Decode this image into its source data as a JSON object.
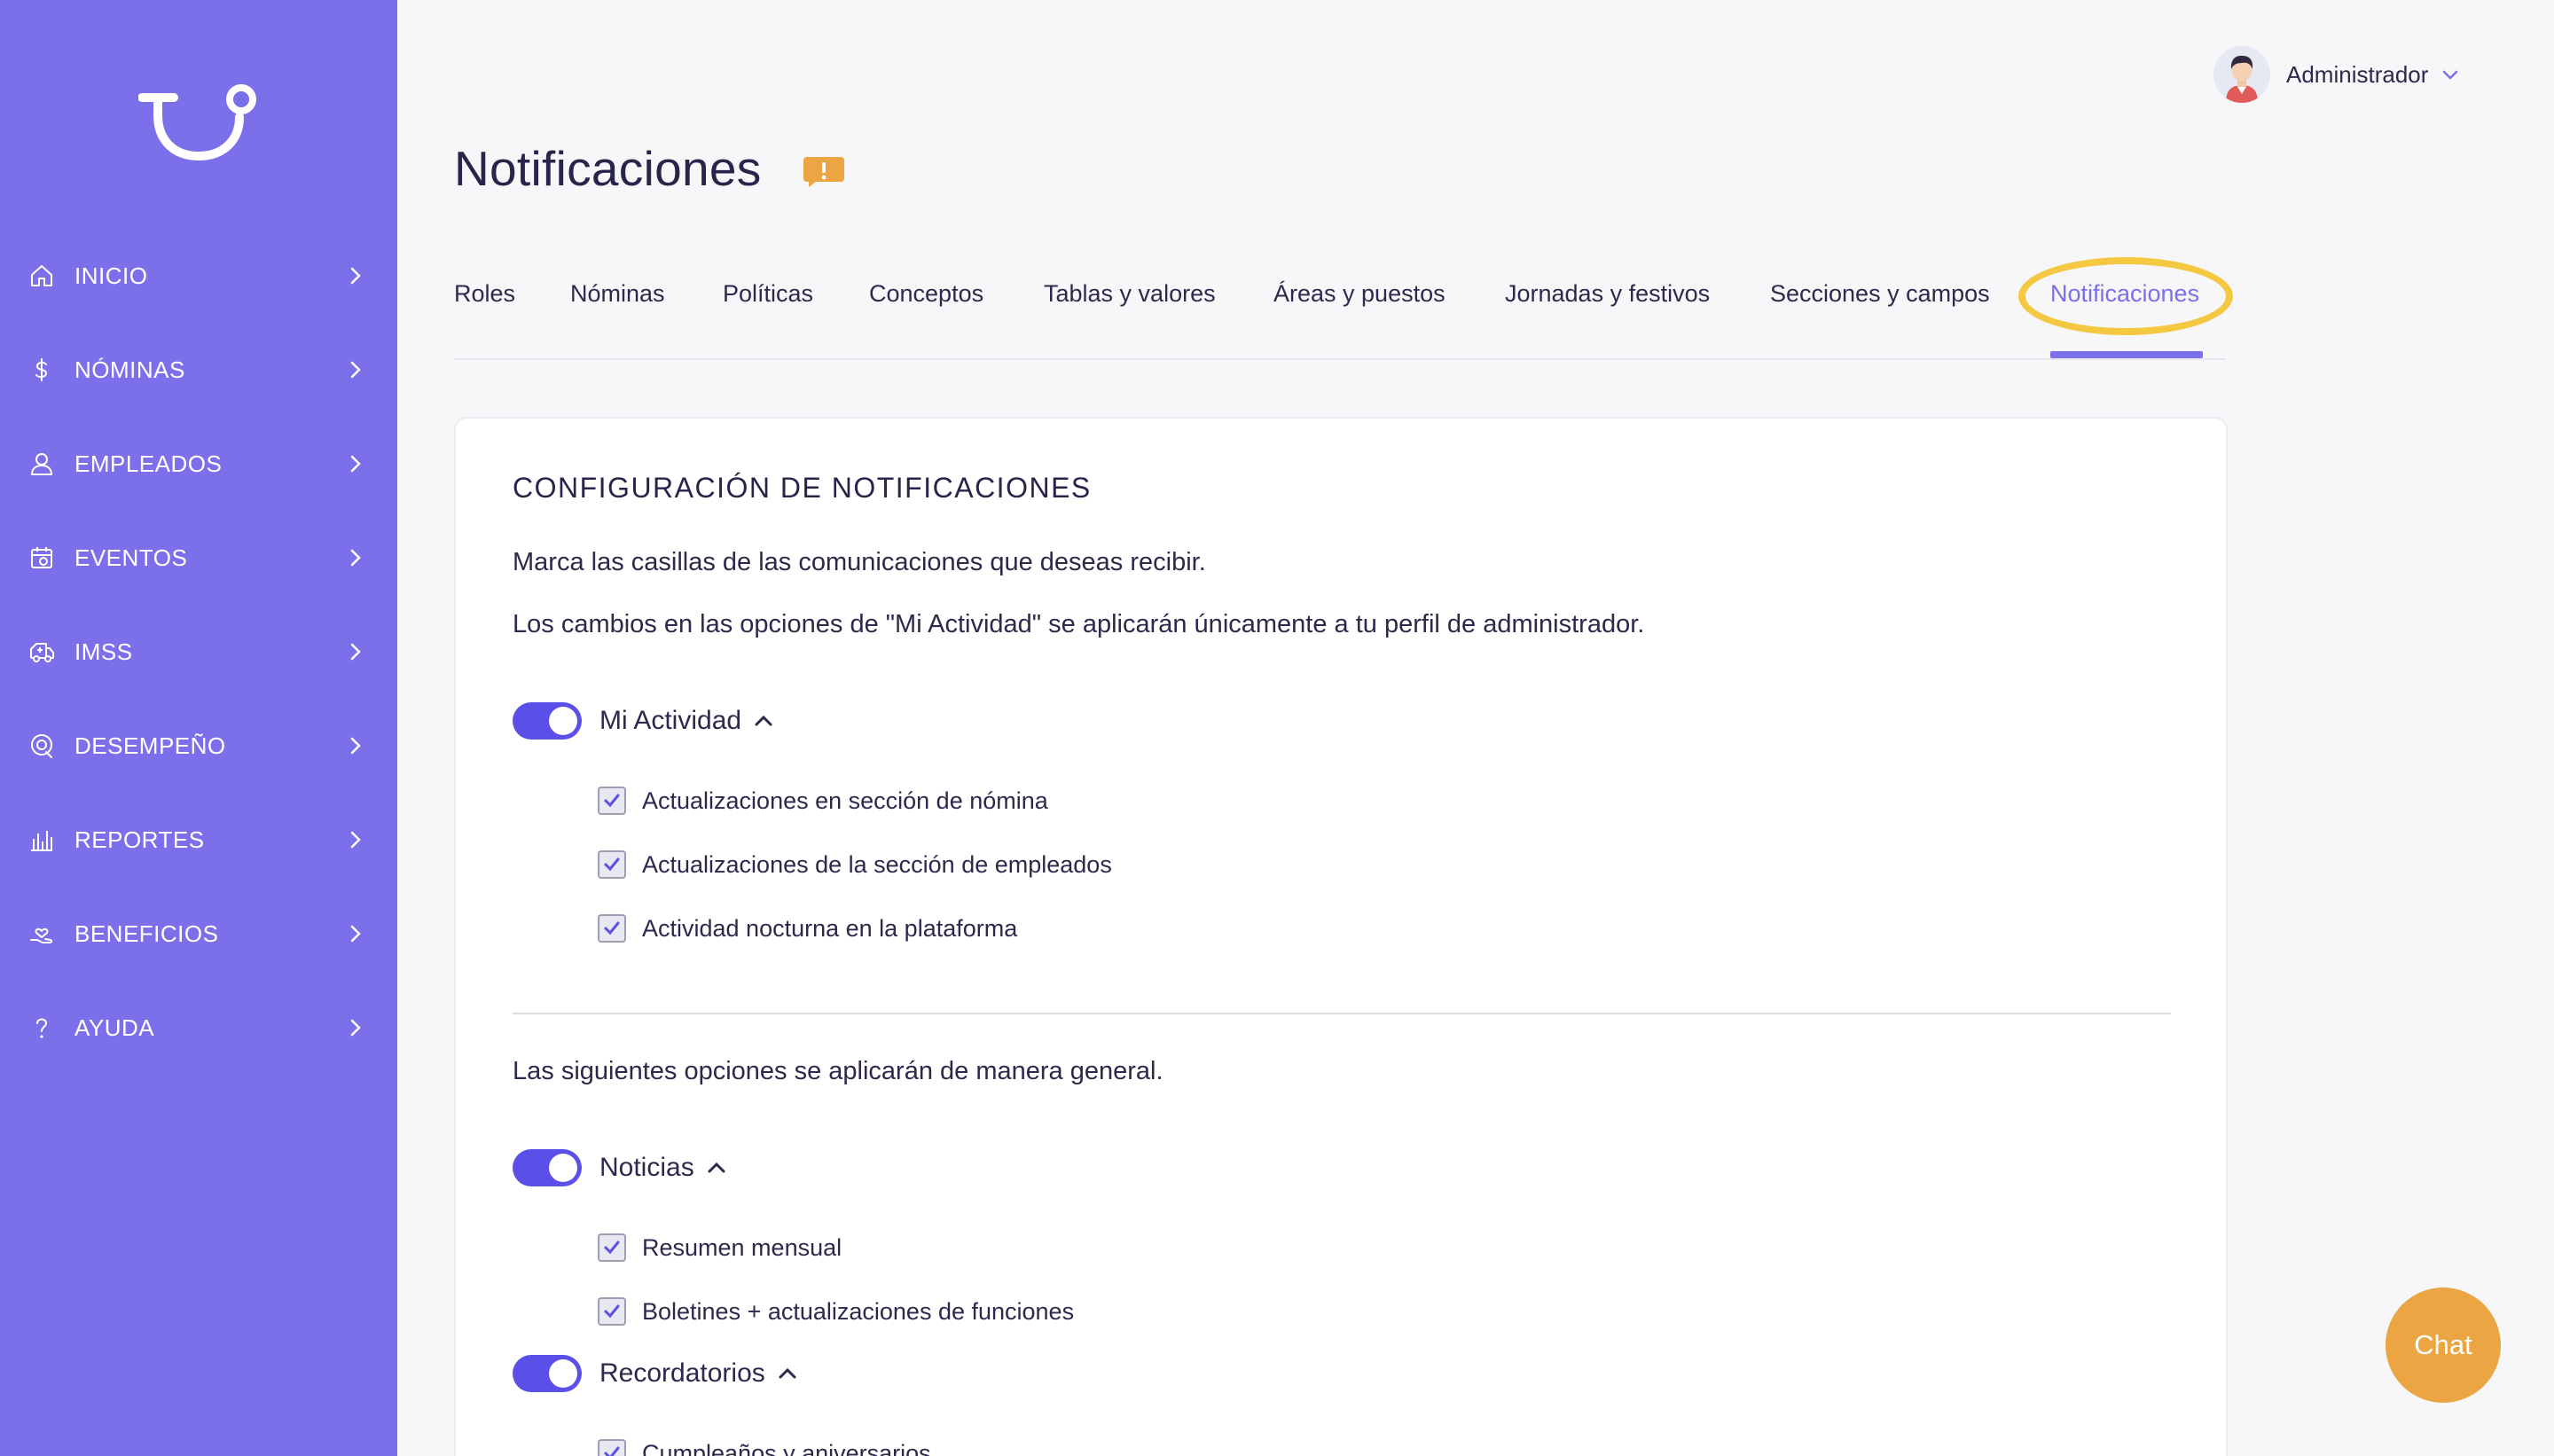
{
  "sidebar": {
    "logo": "logo-icon",
    "items": [
      {
        "label": "INICIO",
        "icon": "home-icon"
      },
      {
        "label": "NÓMINAS",
        "icon": "dollar-icon"
      },
      {
        "label": "EMPLEADOS",
        "icon": "user-icon"
      },
      {
        "label": "EVENTOS",
        "icon": "calendar-icon"
      },
      {
        "label": "IMSS",
        "icon": "ambulance-icon"
      },
      {
        "label": "DESEMPEÑO",
        "icon": "target-icon"
      },
      {
        "label": "REPORTES",
        "icon": "chart-icon"
      },
      {
        "label": "BENEFICIOS",
        "icon": "hand-heart-icon"
      },
      {
        "label": "AYUDA",
        "icon": "question-icon"
      }
    ]
  },
  "header": {
    "user_name": "Administrador",
    "page_title": "Notificaciones"
  },
  "tabs": [
    {
      "label": "Roles"
    },
    {
      "label": "Nóminas"
    },
    {
      "label": "Políticas"
    },
    {
      "label": "Conceptos"
    },
    {
      "label": "Tablas y valores"
    },
    {
      "label": "Áreas y puestos"
    },
    {
      "label": "Jornadas y festivos"
    },
    {
      "label": "Secciones y campos"
    },
    {
      "label": "Notificaciones",
      "active": true
    }
  ],
  "card": {
    "title": "CONFIGURACIÓN DE NOTIFICACIONES",
    "desc1": "Marca las casillas de las comunicaciones que deseas recibir.",
    "desc2": "Los cambios en las opciones de \"Mi Actividad\" se aplicarán únicamente a tu perfil de administrador.",
    "general_desc": "Las siguientes opciones se aplicarán de manera general.",
    "groups": [
      {
        "label": "Mi Actividad",
        "enabled": true,
        "items": [
          {
            "label": "Actualizaciones en sección de nómina",
            "checked": true
          },
          {
            "label": "Actualizaciones de la sección de empleados",
            "checked": true
          },
          {
            "label": "Actividad nocturna en la plataforma",
            "checked": true
          }
        ]
      },
      {
        "label": "Noticias",
        "enabled": true,
        "items": [
          {
            "label": "Resumen mensual",
            "checked": true
          },
          {
            "label": "Boletines + actualizaciones de funciones",
            "checked": true
          }
        ]
      },
      {
        "label": "Recordatorios",
        "enabled": true,
        "items": [
          {
            "label": "Cumpleaños y aniversarios",
            "checked": true
          }
        ]
      }
    ]
  },
  "chat": {
    "label": "Chat"
  },
  "colors": {
    "sidebar": "#7b70ea",
    "accent": "#5a4fe6",
    "highlight": "#f5c842",
    "chat": "#eba643",
    "badge": "#eba643"
  }
}
